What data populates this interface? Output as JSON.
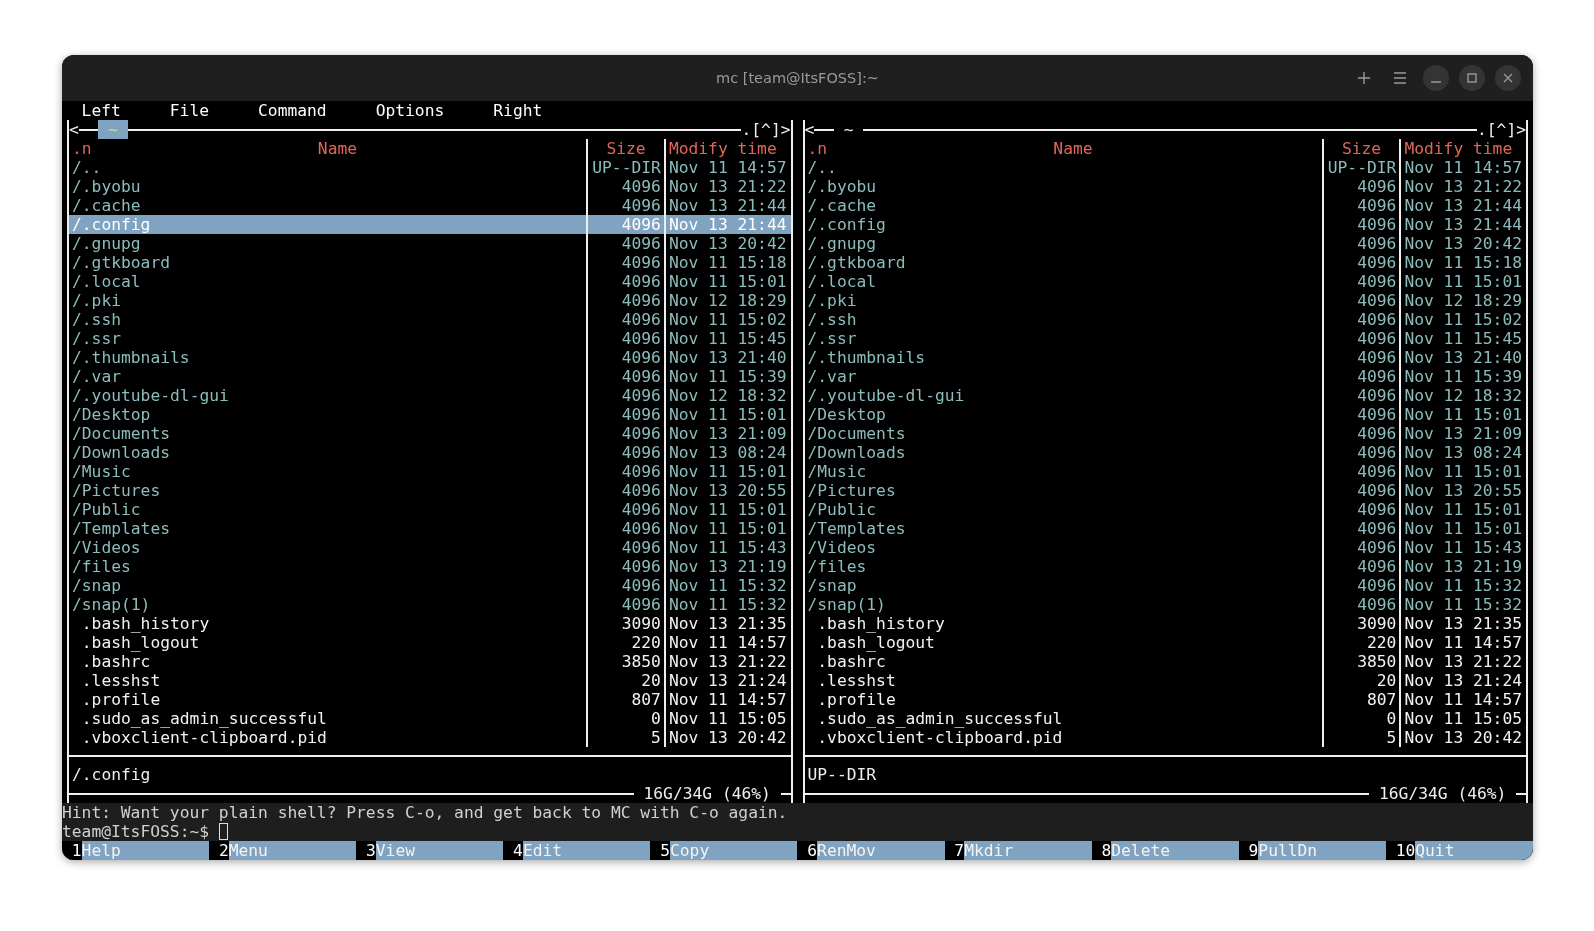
{
  "window": {
    "title": "mc [team@ItsFOSS]:~"
  },
  "menu": [
    "Left",
    "File",
    "Command",
    "Options",
    "Right"
  ],
  "panels": [
    {
      "active": true,
      "nav_left": "<",
      "path": "~",
      "nav_right": ".[^]>",
      "columns": [
        ".n",
        "Name",
        "Size",
        "Modify time"
      ],
      "status": "/.config",
      "disk": "16G/34G (46%)",
      "rows": [
        {
          "name": "/..",
          "size": "UP--DIR",
          "modified": "Nov 11 14:57",
          "kind": "dir",
          "selected": false
        },
        {
          "name": "/.byobu",
          "size": "4096",
          "modified": "Nov 13 21:22",
          "kind": "dir",
          "selected": false
        },
        {
          "name": "/.cache",
          "size": "4096",
          "modified": "Nov 13 21:44",
          "kind": "dir",
          "selected": false
        },
        {
          "name": "/.config",
          "size": "4096",
          "modified": "Nov 13 21:44",
          "kind": "dir",
          "selected": true
        },
        {
          "name": "/.gnupg",
          "size": "4096",
          "modified": "Nov 13 20:42",
          "kind": "dir",
          "selected": false
        },
        {
          "name": "/.gtkboard",
          "size": "4096",
          "modified": "Nov 11 15:18",
          "kind": "dir",
          "selected": false
        },
        {
          "name": "/.local",
          "size": "4096",
          "modified": "Nov 11 15:01",
          "kind": "dir",
          "selected": false
        },
        {
          "name": "/.pki",
          "size": "4096",
          "modified": "Nov 12 18:29",
          "kind": "dir",
          "selected": false
        },
        {
          "name": "/.ssh",
          "size": "4096",
          "modified": "Nov 11 15:02",
          "kind": "dir",
          "selected": false
        },
        {
          "name": "/.ssr",
          "size": "4096",
          "modified": "Nov 11 15:45",
          "kind": "dir",
          "selected": false
        },
        {
          "name": "/.thumbnails",
          "size": "4096",
          "modified": "Nov 13 21:40",
          "kind": "dir",
          "selected": false
        },
        {
          "name": "/.var",
          "size": "4096",
          "modified": "Nov 11 15:39",
          "kind": "dir",
          "selected": false
        },
        {
          "name": "/.youtube-dl-gui",
          "size": "4096",
          "modified": "Nov 12 18:32",
          "kind": "dir",
          "selected": false
        },
        {
          "name": "/Desktop",
          "size": "4096",
          "modified": "Nov 11 15:01",
          "kind": "dir",
          "selected": false
        },
        {
          "name": "/Documents",
          "size": "4096",
          "modified": "Nov 13 21:09",
          "kind": "dir",
          "selected": false
        },
        {
          "name": "/Downloads",
          "size": "4096",
          "modified": "Nov 13 08:24",
          "kind": "dir",
          "selected": false
        },
        {
          "name": "/Music",
          "size": "4096",
          "modified": "Nov 11 15:01",
          "kind": "dir",
          "selected": false
        },
        {
          "name": "/Pictures",
          "size": "4096",
          "modified": "Nov 13 20:55",
          "kind": "dir",
          "selected": false
        },
        {
          "name": "/Public",
          "size": "4096",
          "modified": "Nov 11 15:01",
          "kind": "dir",
          "selected": false
        },
        {
          "name": "/Templates",
          "size": "4096",
          "modified": "Nov 11 15:01",
          "kind": "dir",
          "selected": false
        },
        {
          "name": "/Videos",
          "size": "4096",
          "modified": "Nov 11 15:43",
          "kind": "dir",
          "selected": false
        },
        {
          "name": "/files",
          "size": "4096",
          "modified": "Nov 13 21:19",
          "kind": "dir",
          "selected": false
        },
        {
          "name": "/snap",
          "size": "4096",
          "modified": "Nov 11 15:32",
          "kind": "dir",
          "selected": false
        },
        {
          "name": "/snap(1)",
          "size": "4096",
          "modified": "Nov 11 15:32",
          "kind": "dir",
          "selected": false
        },
        {
          "name": ".bash_history",
          "size": "3090",
          "modified": "Nov 13 21:35",
          "kind": "file",
          "selected": false
        },
        {
          "name": ".bash_logout",
          "size": "220",
          "modified": "Nov 11 14:57",
          "kind": "file",
          "selected": false
        },
        {
          "name": ".bashrc",
          "size": "3850",
          "modified": "Nov 13 21:22",
          "kind": "file",
          "selected": false
        },
        {
          "name": ".lesshst",
          "size": "20",
          "modified": "Nov 13 21:24",
          "kind": "file",
          "selected": false
        },
        {
          "name": ".profile",
          "size": "807",
          "modified": "Nov 11 14:57",
          "kind": "file",
          "selected": false
        },
        {
          "name": ".sudo_as_admin_successful",
          "size": "0",
          "modified": "Nov 11 15:05",
          "kind": "file",
          "selected": false
        },
        {
          "name": ".vboxclient-clipboard.pid",
          "size": "5",
          "modified": "Nov 13 20:42",
          "kind": "file",
          "selected": false
        }
      ]
    },
    {
      "active": false,
      "nav_left": "<",
      "path": "~",
      "nav_right": ".[^]>",
      "columns": [
        ".n",
        "Name",
        "Size",
        "Modify time"
      ],
      "status": "UP--DIR",
      "disk": "16G/34G (46%)",
      "rows": [
        {
          "name": "/..",
          "size": "UP--DIR",
          "modified": "Nov 11 14:57",
          "kind": "dir",
          "selected": false
        },
        {
          "name": "/.byobu",
          "size": "4096",
          "modified": "Nov 13 21:22",
          "kind": "dir",
          "selected": false
        },
        {
          "name": "/.cache",
          "size": "4096",
          "modified": "Nov 13 21:44",
          "kind": "dir",
          "selected": false
        },
        {
          "name": "/.config",
          "size": "4096",
          "modified": "Nov 13 21:44",
          "kind": "dir",
          "selected": false
        },
        {
          "name": "/.gnupg",
          "size": "4096",
          "modified": "Nov 13 20:42",
          "kind": "dir",
          "selected": false
        },
        {
          "name": "/.gtkboard",
          "size": "4096",
          "modified": "Nov 11 15:18",
          "kind": "dir",
          "selected": false
        },
        {
          "name": "/.local",
          "size": "4096",
          "modified": "Nov 11 15:01",
          "kind": "dir",
          "selected": false
        },
        {
          "name": "/.pki",
          "size": "4096",
          "modified": "Nov 12 18:29",
          "kind": "dir",
          "selected": false
        },
        {
          "name": "/.ssh",
          "size": "4096",
          "modified": "Nov 11 15:02",
          "kind": "dir",
          "selected": false
        },
        {
          "name": "/.ssr",
          "size": "4096",
          "modified": "Nov 11 15:45",
          "kind": "dir",
          "selected": false
        },
        {
          "name": "/.thumbnails",
          "size": "4096",
          "modified": "Nov 13 21:40",
          "kind": "dir",
          "selected": false
        },
        {
          "name": "/.var",
          "size": "4096",
          "modified": "Nov 11 15:39",
          "kind": "dir",
          "selected": false
        },
        {
          "name": "/.youtube-dl-gui",
          "size": "4096",
          "modified": "Nov 12 18:32",
          "kind": "dir",
          "selected": false
        },
        {
          "name": "/Desktop",
          "size": "4096",
          "modified": "Nov 11 15:01",
          "kind": "dir",
          "selected": false
        },
        {
          "name": "/Documents",
          "size": "4096",
          "modified": "Nov 13 21:09",
          "kind": "dir",
          "selected": false
        },
        {
          "name": "/Downloads",
          "size": "4096",
          "modified": "Nov 13 08:24",
          "kind": "dir",
          "selected": false
        },
        {
          "name": "/Music",
          "size": "4096",
          "modified": "Nov 11 15:01",
          "kind": "dir",
          "selected": false
        },
        {
          "name": "/Pictures",
          "size": "4096",
          "modified": "Nov 13 20:55",
          "kind": "dir",
          "selected": false
        },
        {
          "name": "/Public",
          "size": "4096",
          "modified": "Nov 11 15:01",
          "kind": "dir",
          "selected": false
        },
        {
          "name": "/Templates",
          "size": "4096",
          "modified": "Nov 11 15:01",
          "kind": "dir",
          "selected": false
        },
        {
          "name": "/Videos",
          "size": "4096",
          "modified": "Nov 11 15:43",
          "kind": "dir",
          "selected": false
        },
        {
          "name": "/files",
          "size": "4096",
          "modified": "Nov 13 21:19",
          "kind": "dir",
          "selected": false
        },
        {
          "name": "/snap",
          "size": "4096",
          "modified": "Nov 11 15:32",
          "kind": "dir",
          "selected": false
        },
        {
          "name": "/snap(1)",
          "size": "4096",
          "modified": "Nov 11 15:32",
          "kind": "dir",
          "selected": false
        },
        {
          "name": ".bash_history",
          "size": "3090",
          "modified": "Nov 13 21:35",
          "kind": "file",
          "selected": false
        },
        {
          "name": ".bash_logout",
          "size": "220",
          "modified": "Nov 11 14:57",
          "kind": "file",
          "selected": false
        },
        {
          "name": ".bashrc",
          "size": "3850",
          "modified": "Nov 13 21:22",
          "kind": "file",
          "selected": false
        },
        {
          "name": ".lesshst",
          "size": "20",
          "modified": "Nov 13 21:24",
          "kind": "file",
          "selected": false
        },
        {
          "name": ".profile",
          "size": "807",
          "modified": "Nov 11 14:57",
          "kind": "file",
          "selected": false
        },
        {
          "name": ".sudo_as_admin_successful",
          "size": "0",
          "modified": "Nov 11 15:05",
          "kind": "file",
          "selected": false
        },
        {
          "name": ".vboxclient-clipboard.pid",
          "size": "5",
          "modified": "Nov 13 20:42",
          "kind": "file",
          "selected": false
        }
      ]
    }
  ],
  "hint": "Hint: Want your plain shell? Press C-o, and get back to MC with C-o again.",
  "prompt": "team@ItsFOSS:~$",
  "function_keys": [
    {
      "number": "1",
      "label": "Help"
    },
    {
      "number": "2",
      "label": "Menu"
    },
    {
      "number": "3",
      "label": "View"
    },
    {
      "number": "4",
      "label": "Edit"
    },
    {
      "number": "5",
      "label": "Copy"
    },
    {
      "number": "6",
      "label": "RenMov"
    },
    {
      "number": "7",
      "label": "Mkdir"
    },
    {
      "number": "8",
      "label": "Delete"
    },
    {
      "number": "9",
      "label": "PullDn"
    },
    {
      "number": "10",
      "label": "Quit"
    }
  ]
}
